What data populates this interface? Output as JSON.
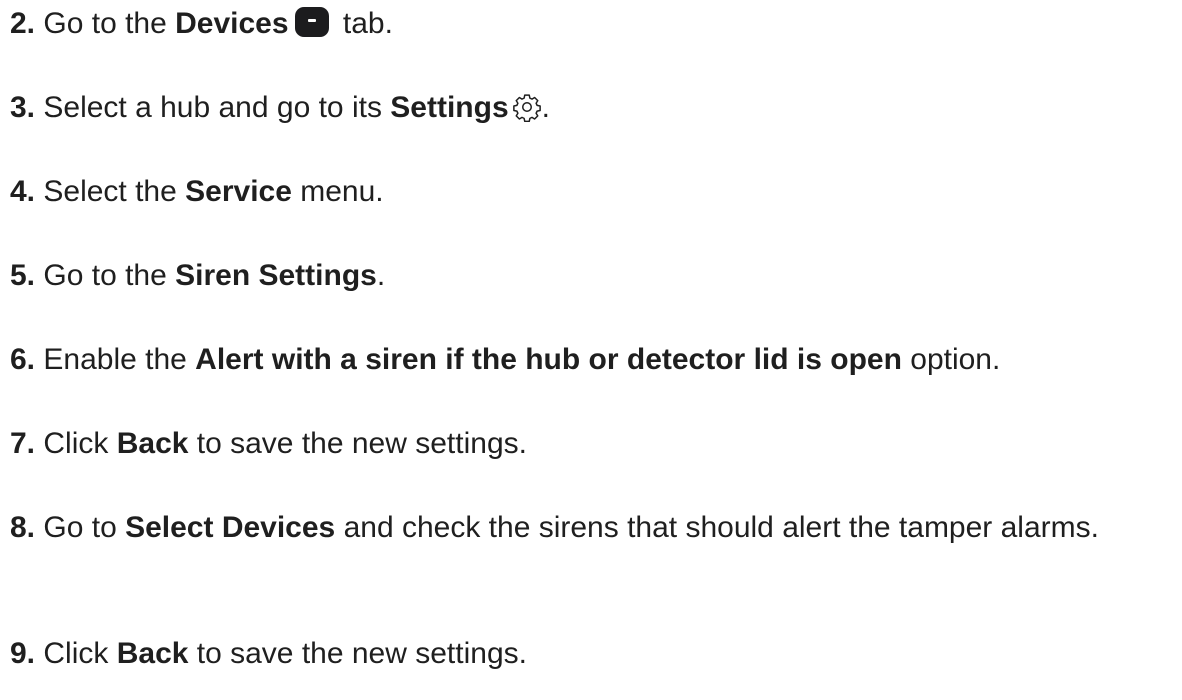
{
  "steps": [
    {
      "num": "2.",
      "parts": [
        "Go to the ",
        "Devices",
        "tab."
      ]
    },
    {
      "num": "3.",
      "parts": [
        "Select a hub and go to its ",
        "Settings",
        "."
      ]
    },
    {
      "num": "4.",
      "parts": [
        "Select the ",
        "Service",
        " menu."
      ]
    },
    {
      "num": "5.",
      "parts": [
        "Go to the ",
        "Siren Settings",
        "."
      ]
    },
    {
      "num": "6.",
      "parts": [
        "Enable the ",
        "Alert with a siren if the hub or detector lid is open",
        " option."
      ]
    },
    {
      "num": "7.",
      "parts": [
        "Click ",
        "Back",
        " to save the new settings."
      ]
    },
    {
      "num": "8.",
      "parts": [
        "Go to ",
        "Select Devices",
        " and check the sirens that should alert the tamper alarms."
      ]
    },
    {
      "num": "9.",
      "parts": [
        "Click ",
        "Back",
        " to save the new settings."
      ]
    }
  ],
  "icons": {
    "devices": "devices-tab-icon",
    "settings": "gear-icon"
  }
}
